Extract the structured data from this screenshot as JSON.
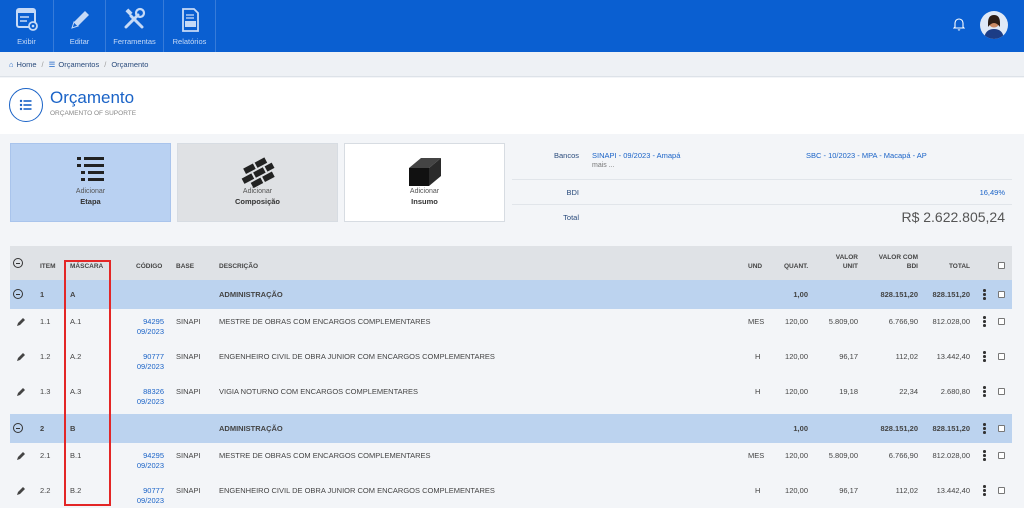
{
  "toolbar": {
    "items": [
      {
        "label": "Exibir",
        "icon": "view-icon"
      },
      {
        "label": "Editar",
        "icon": "pencil-icon"
      },
      {
        "label": "Ferramentas",
        "icon": "tools-icon"
      },
      {
        "label": "Relatórios",
        "icon": "report-icon"
      }
    ]
  },
  "breadcrumb": {
    "home": "Home",
    "level1": "Orçamentos",
    "level2": "Orçamento"
  },
  "page": {
    "title": "Orçamento",
    "subtitle": "ORÇAMENTO OF SUPORTE"
  },
  "actions": [
    {
      "line1": "Adicionar",
      "line2": "Etapa"
    },
    {
      "line1": "Adicionar",
      "line2": "Composição"
    },
    {
      "line1": "Adicionar",
      "line2": "Insumo"
    }
  ],
  "summary": {
    "banks_label": "Bancos",
    "bank1": "SINAPI - 09/2023 - Amapá",
    "bank1_more": "mais ...",
    "bank2": "SBC - 10/2023 - MPA - Macapá - AP",
    "bdi_label": "BDI",
    "bdi_value": "16,49%",
    "total_label": "Total",
    "total_value": "R$ 2.622.805,24"
  },
  "table": {
    "headers": {
      "item": "ITEM",
      "mascara": "MÁSCARA",
      "codigo": "CÓDIGO",
      "base": "BASE",
      "descricao": "DESCRIÇÃO",
      "und": "UND",
      "quant": "QUANT.",
      "valor_unit_1": "VALOR",
      "valor_unit_2": "UNIT",
      "valor_bdi_1": "VALOR COM",
      "valor_bdi_2": "BDI",
      "total": "TOTAL"
    },
    "rows": [
      {
        "kind": "group",
        "item": "1",
        "mascara": "A",
        "descricao": "ADMINISTRAÇÃO",
        "quant": "1,00",
        "valor_bdi": "828.151,20",
        "total": "828.151,20"
      },
      {
        "kind": "item",
        "item": "1.1",
        "mascara": "A.1",
        "codigo": "94295",
        "data": "09/2023",
        "base": "SINAPI",
        "descricao": "MESTRE DE OBRAS COM ENCARGOS COMPLEMENTARES",
        "und": "MES",
        "quant": "120,00",
        "valor_unit": "5.809,00",
        "valor_bdi": "6.766,90",
        "total": "812.028,00"
      },
      {
        "kind": "item",
        "item": "1.2",
        "mascara": "A.2",
        "codigo": "90777",
        "data": "09/2023",
        "base": "SINAPI",
        "descricao": "ENGENHEIRO CIVIL DE OBRA JUNIOR COM ENCARGOS COMPLEMENTARES",
        "und": "H",
        "quant": "120,00",
        "valor_unit": "96,17",
        "valor_bdi": "112,02",
        "total": "13.442,40"
      },
      {
        "kind": "item",
        "item": "1.3",
        "mascara": "A.3",
        "codigo": "88326",
        "data": "09/2023",
        "base": "SINAPI",
        "descricao": "VIGIA NOTURNO COM ENCARGOS COMPLEMENTARES",
        "und": "H",
        "quant": "120,00",
        "valor_unit": "19,18",
        "valor_bdi": "22,34",
        "total": "2.680,80"
      },
      {
        "kind": "group",
        "item": "2",
        "mascara": "B",
        "descricao": "ADMINISTRAÇÃO",
        "quant": "1,00",
        "valor_bdi": "828.151,20",
        "total": "828.151,20"
      },
      {
        "kind": "item",
        "item": "2.1",
        "mascara": "B.1",
        "codigo": "94295",
        "data": "09/2023",
        "base": "SINAPI",
        "descricao": "MESTRE DE OBRAS COM ENCARGOS COMPLEMENTARES",
        "und": "MES",
        "quant": "120,00",
        "valor_unit": "5.809,00",
        "valor_bdi": "6.766,90",
        "total": "812.028,00"
      },
      {
        "kind": "item",
        "item": "2.2",
        "mascara": "B.2",
        "codigo": "90777",
        "data": "09/2023",
        "base": "SINAPI",
        "descricao": "ENGENHEIRO CIVIL DE OBRA JUNIOR COM ENCARGOS COMPLEMENTARES",
        "und": "H",
        "quant": "120,00",
        "valor_unit": "96,17",
        "valor_bdi": "112,02",
        "total": "13.442,40"
      }
    ]
  },
  "colors": {
    "primary": "#0a5fd1",
    "group_row": "#bcd3ef",
    "highlight": "#e32626"
  }
}
